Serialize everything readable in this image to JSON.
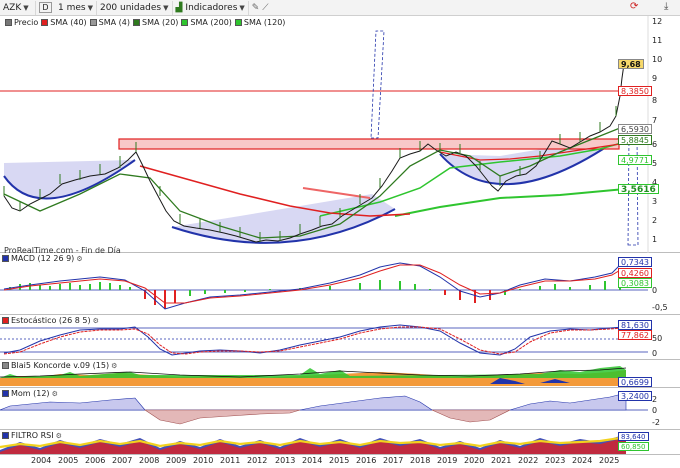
{
  "toolbar": {
    "symbol": "AZK",
    "period_badge": "D",
    "timeframe": "1 mes",
    "units": "200 unidades",
    "indicators": "Indicadores"
  },
  "legend": [
    {
      "label": "Precio",
      "color": "#777777"
    },
    {
      "label": "SMA (40)",
      "color": "#e02020"
    },
    {
      "label": "SMA (4)",
      "color": "#999999"
    },
    {
      "label": "SMA (20)",
      "color": "#2f7a1f"
    },
    {
      "label": "SMA (200)",
      "color": "#2fc52f"
    },
    {
      "label": "SMA (120)",
      "color": "#2fc52f"
    }
  ],
  "source_text": "ProRealTime.com - Fin de Día",
  "price_axis": {
    "ticks": [
      "12",
      "11",
      "10",
      "9",
      "8",
      "7",
      "6",
      "5",
      "4",
      "3",
      "2",
      "1"
    ],
    "last": "9,68",
    "resistance": "8,3850",
    "sma4": "6,5930",
    "sma20": "5,8845",
    "sma40": "4,9771",
    "sma200": "3,5616"
  },
  "indicators": {
    "macd": {
      "label": "MACD (12 26 9)",
      "v1": "0,7343",
      "v2": "0,4260",
      "v3": "0,3083",
      "ticks": [
        "0",
        "-0,5"
      ]
    },
    "stoch": {
      "label": "Estocástico (26 8 5)",
      "v1": "81,630",
      "v2": "77,862",
      "ticks": [
        "50",
        "0"
      ]
    },
    "koncorde": {
      "label": "Blai5 Koncorde v.09 (15)",
      "v1": "0,6699"
    },
    "mom": {
      "label": "Mom (12)",
      "v1": "3,2400",
      "ticks": [
        "2",
        "0",
        "-2"
      ]
    },
    "rsi": {
      "label": "FILTRO RSI",
      "v1": "83,640",
      "v2": "60,850"
    }
  },
  "years": [
    "2004",
    "2005",
    "2006",
    "2007",
    "2008",
    "2009",
    "2010",
    "2011",
    "2012",
    "2013",
    "2014",
    "2015",
    "2016",
    "2017",
    "2018",
    "2019",
    "2020",
    "2021",
    "2022",
    "2023",
    "2024",
    "2025"
  ],
  "colors": {
    "bg": "#ffffff",
    "up": "#2f7a1f",
    "red": "#e02020",
    "green": "#2fc52f",
    "blue": "#2233aa"
  }
}
